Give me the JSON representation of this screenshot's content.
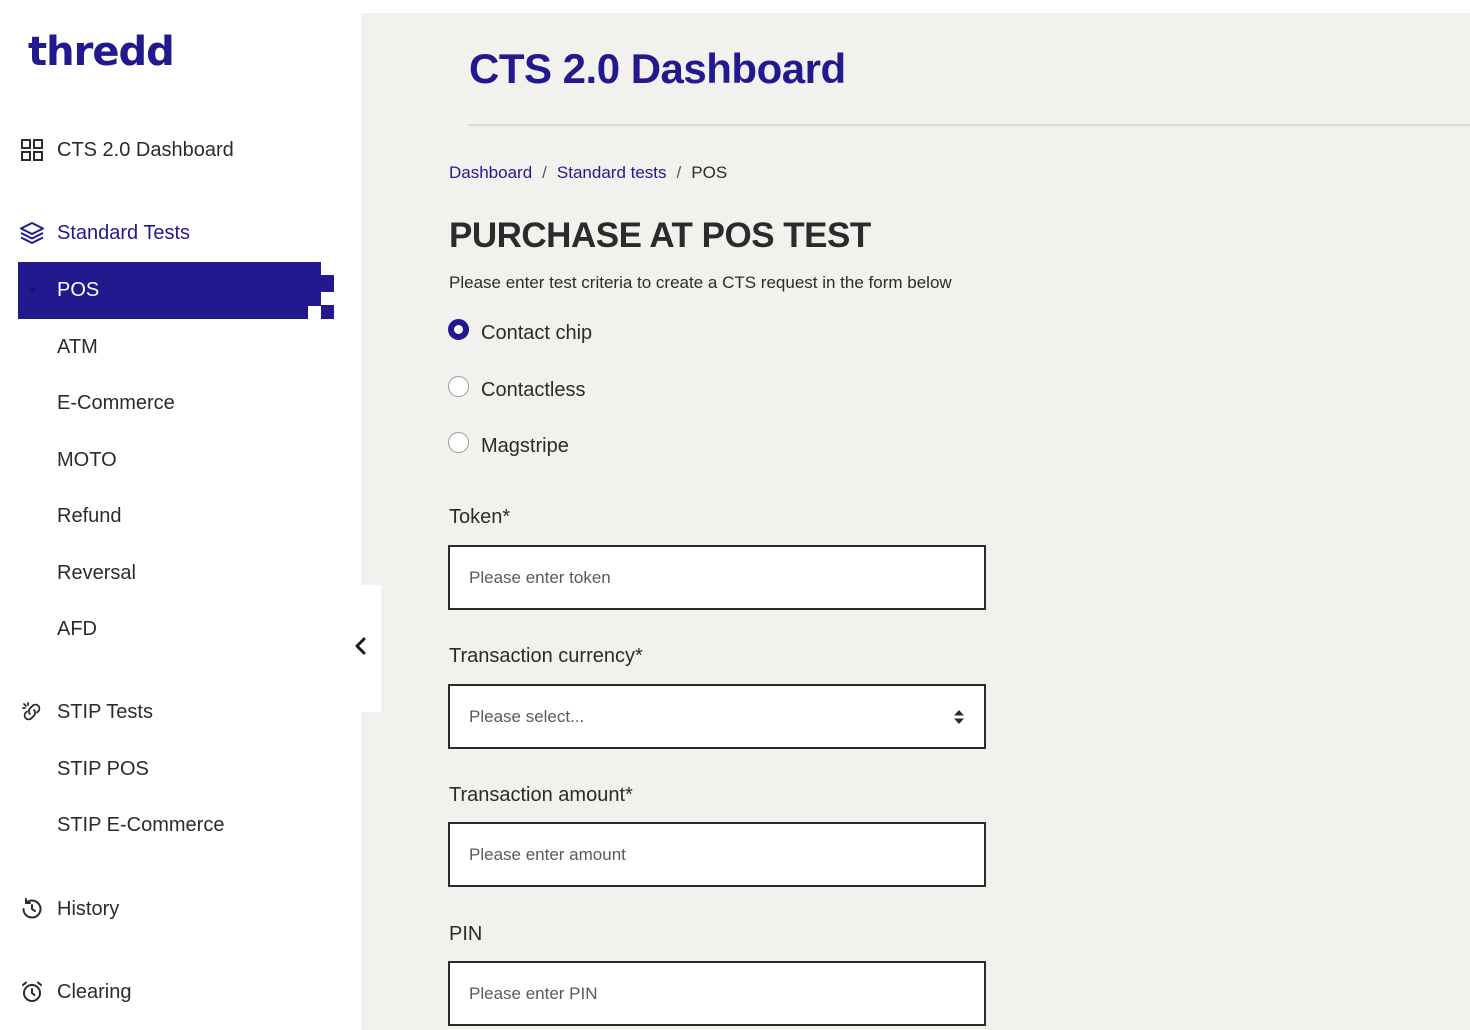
{
  "brand": {
    "logo_text": "thredd",
    "accent_color": "#23198f"
  },
  "sidebar": {
    "dashboard": {
      "label": "CTS 2.0 Dashboard",
      "icon": "grid-icon"
    },
    "standard_tests": {
      "label": "Standard Tests",
      "icon": "layers-icon",
      "items": [
        {
          "label": "POS",
          "active": true
        },
        {
          "label": "ATM"
        },
        {
          "label": "E-Commerce"
        },
        {
          "label": "MOTO"
        },
        {
          "label": "Refund"
        },
        {
          "label": "Reversal"
        },
        {
          "label": "AFD"
        }
      ]
    },
    "stip_tests": {
      "label": "STIP Tests",
      "icon": "link-icon",
      "items": [
        {
          "label": "STIP POS"
        },
        {
          "label": "STIP E-Commerce"
        }
      ]
    },
    "history": {
      "label": "History",
      "icon": "history-icon"
    },
    "clearing": {
      "label": "Clearing",
      "icon": "alarm-clock-icon"
    }
  },
  "header": {
    "title": "CTS 2.0 Dashboard"
  },
  "breadcrumb": {
    "items": [
      "Dashboard",
      "Standard tests",
      "POS"
    ],
    "separator": "/"
  },
  "form": {
    "title": "PURCHASE AT POS TEST",
    "description": "Please enter test criteria to create a CTS request in the form below",
    "card_types": [
      {
        "label": "Contact chip",
        "checked": true
      },
      {
        "label": "Contactless",
        "checked": false
      },
      {
        "label": "Magstripe",
        "checked": false
      }
    ],
    "token": {
      "label": "Token*",
      "placeholder": "Please enter token"
    },
    "currency": {
      "label": "Transaction currency*",
      "placeholder": "Please select..."
    },
    "amount": {
      "label": "Transaction amount*",
      "placeholder": "Please enter amount"
    },
    "pin": {
      "label": "PIN",
      "placeholder": "Please enter PIN"
    }
  }
}
